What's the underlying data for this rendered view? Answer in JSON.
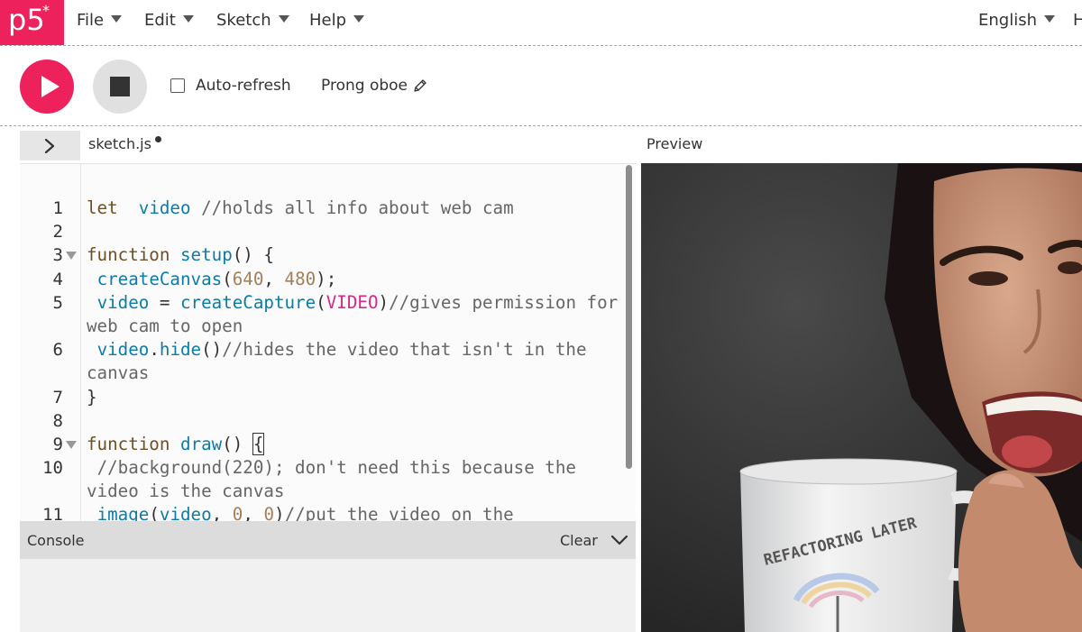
{
  "app": {
    "logo": "p5",
    "logo_mark": "*"
  },
  "nav": {
    "menus": [
      {
        "label": "File"
      },
      {
        "label": "Edit"
      },
      {
        "label": "Sketch"
      },
      {
        "label": "Help"
      }
    ],
    "language": "English",
    "cutoff": "H"
  },
  "toolbar": {
    "auto_refresh_label": "Auto-refresh",
    "auto_refresh_checked": false,
    "sketch_name": "Prong oboe"
  },
  "editor": {
    "file_name": "sketch.js",
    "unsaved": true,
    "preview_label": "Preview",
    "lines": [
      {
        "n": "1",
        "tokens": [
          [
            "kw",
            "let"
          ],
          [
            "",
            "  "
          ],
          [
            "fn",
            "video"
          ],
          [
            "cm",
            " //holds all info about web cam"
          ]
        ]
      },
      {
        "n": "2",
        "tokens": []
      },
      {
        "n": "3",
        "fold": true,
        "tokens": [
          [
            "kw",
            "function"
          ],
          [
            "",
            " "
          ],
          [
            "fn",
            "setup"
          ],
          [
            "",
            "() {"
          ]
        ]
      },
      {
        "n": "4",
        "tokens": [
          [
            "",
            " "
          ],
          [
            "fn",
            "createCanvas"
          ],
          [
            "",
            "("
          ],
          [
            "cn",
            "640"
          ],
          [
            "",
            ", "
          ],
          [
            "cn",
            "480"
          ],
          [
            "",
            ");"
          ]
        ]
      },
      {
        "n": "5",
        "tall": true,
        "tokens": [
          [
            "",
            " "
          ],
          [
            "fn",
            "video"
          ],
          [
            "",
            " = "
          ],
          [
            "fn",
            "createCapture"
          ],
          [
            "",
            "("
          ],
          [
            "vid",
            "VIDEO"
          ],
          [
            "",
            ")"
          ],
          [
            "cm",
            "//gives permission for web cam to open"
          ]
        ]
      },
      {
        "n": "6",
        "tall": true,
        "tokens": [
          [
            "",
            " "
          ],
          [
            "fn",
            "video"
          ],
          [
            "",
            "."
          ],
          [
            "fn",
            "hide"
          ],
          [
            "",
            "()"
          ],
          [
            "cm",
            "//hides the video that isn't in the canvas"
          ]
        ]
      },
      {
        "n": "7",
        "tokens": [
          [
            "",
            "}"
          ]
        ]
      },
      {
        "n": "8",
        "tokens": []
      },
      {
        "n": "9",
        "fold": true,
        "bracket": true,
        "tokens": [
          [
            "kw",
            "function"
          ],
          [
            "",
            " "
          ],
          [
            "fn",
            "draw"
          ],
          [
            "",
            "() "
          ]
        ]
      },
      {
        "n": "10",
        "tall": true,
        "tokens": [
          [
            "",
            " "
          ],
          [
            "cm",
            "//background(220); don't need this because the video is the canvas"
          ]
        ]
      },
      {
        "n": "11",
        "tokens": [
          [
            "",
            " "
          ],
          [
            "fn",
            "image"
          ],
          [
            "",
            "("
          ],
          [
            "fn",
            "video"
          ],
          [
            "",
            ", "
          ],
          [
            "cn",
            "0"
          ],
          [
            "",
            ", "
          ],
          [
            "cn",
            "0"
          ],
          [
            "",
            ")"
          ],
          [
            "cm",
            "//put the video on the"
          ]
        ]
      }
    ],
    "bracket_char": "{"
  },
  "console": {
    "title": "Console",
    "clear_label": "Clear"
  },
  "colors": {
    "brand": "#ed225d",
    "keyword": "#704f21",
    "function": "#0b7ca9",
    "comment": "#666666",
    "number": "#a67f59",
    "constant": "#d52889"
  },
  "icons": {
    "play": "play-icon",
    "stop": "stop-icon",
    "pencil": "pencil-icon",
    "chevron_right": "chevron-right-icon",
    "chevron_down": "chevron-down-icon",
    "caret": "caret-down-icon"
  },
  "preview": {
    "mug_text": "REFACTORING LATER"
  }
}
